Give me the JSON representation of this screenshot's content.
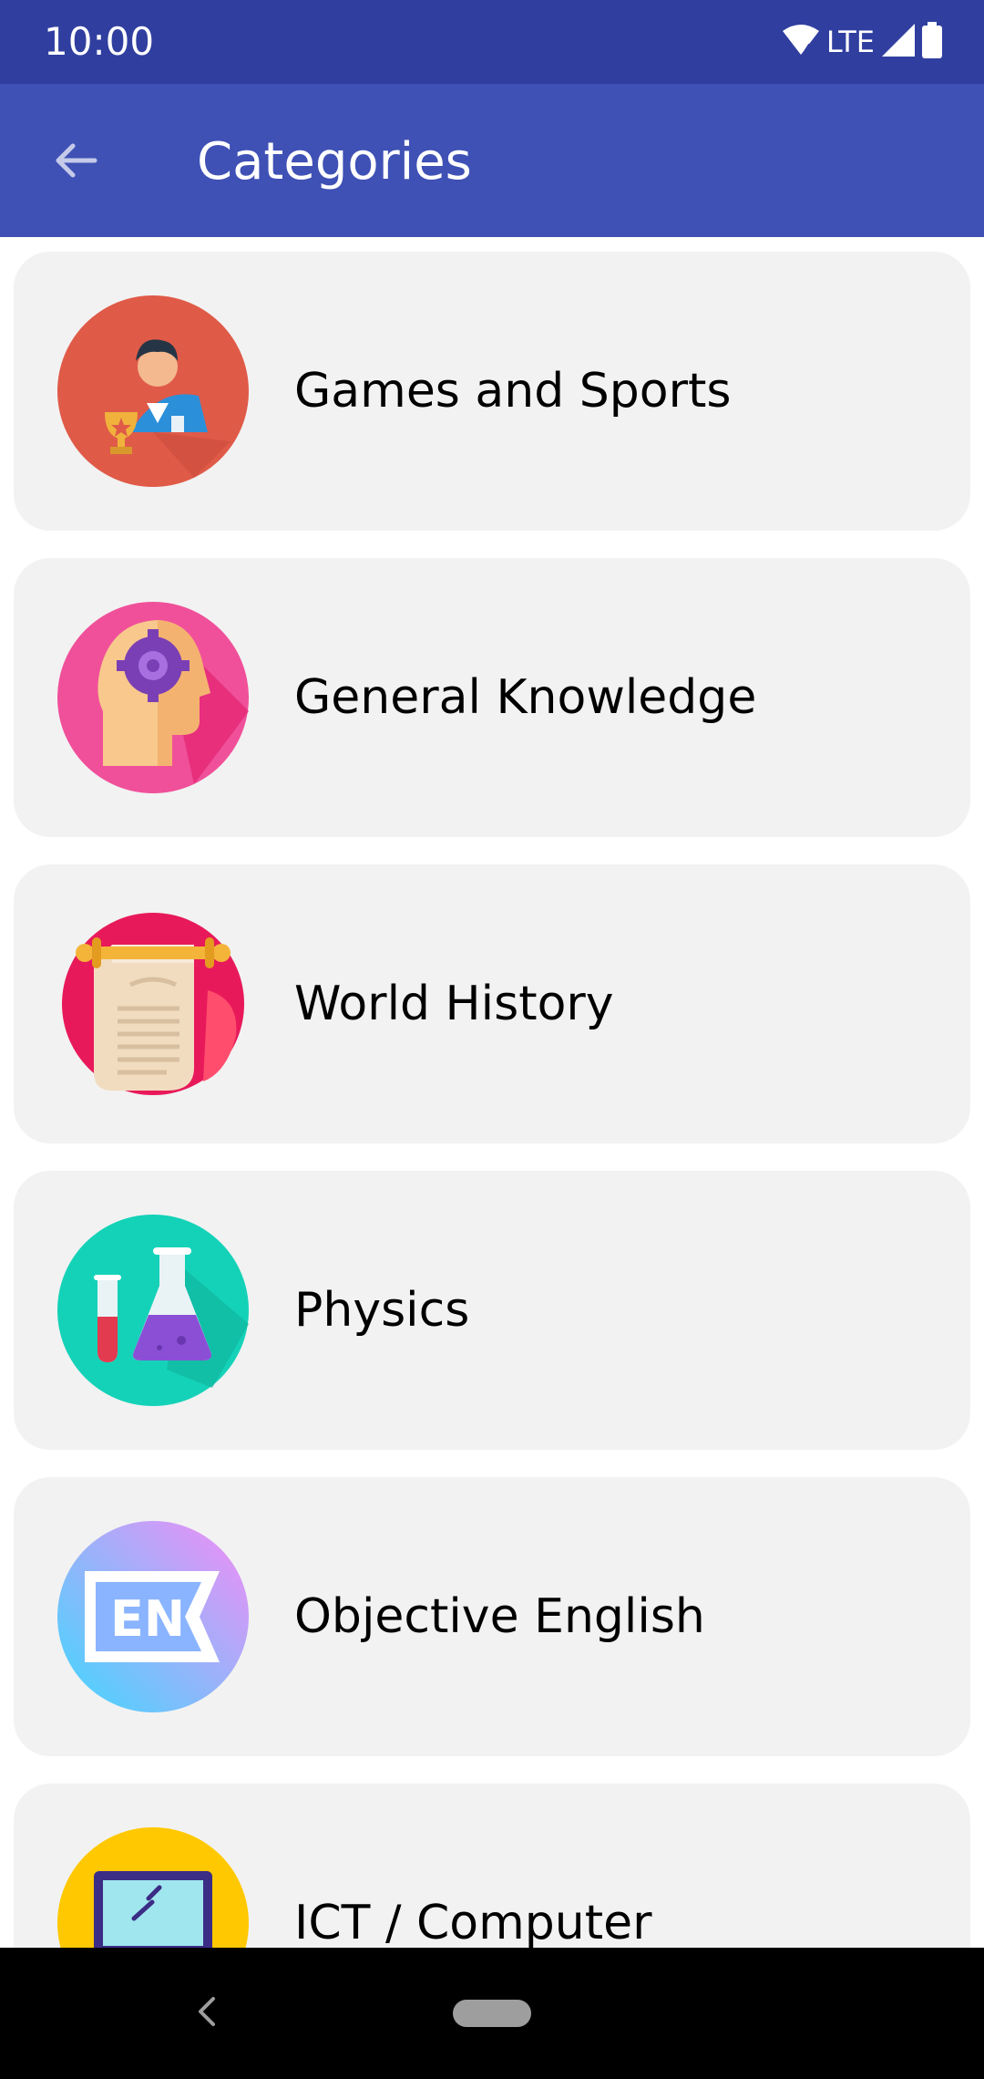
{
  "status_bar": {
    "time": "10:00",
    "network": "LTE",
    "icons": [
      "wifi-icon",
      "signal-icon",
      "battery-icon"
    ]
  },
  "app_bar": {
    "title": "Categories",
    "back_icon": "arrow-back-icon"
  },
  "categories": [
    {
      "label": "Games and Sports",
      "icon": "games-sports-icon",
      "color": "#e05a48"
    },
    {
      "label": "General Knowledge",
      "icon": "general-knowledge-icon",
      "color": "#f0509a"
    },
    {
      "label": "World History",
      "icon": "world-history-icon",
      "color": "#e8195a"
    },
    {
      "label": "Physics",
      "icon": "physics-icon",
      "color": "#14d2b8"
    },
    {
      "label": "Objective English",
      "icon": "objective-english-icon",
      "color": "#9aa6ff"
    },
    {
      "label": "ICT / Computer",
      "icon": "ict-computer-icon",
      "color": "#ffc800"
    }
  ],
  "colors": {
    "status_bar": "#303f9f",
    "app_bar": "#3f51b5",
    "card_background": "#f2f2f2"
  },
  "nav_bar": {
    "back_icon": "nav-back-icon",
    "home_icon": "nav-home-pill"
  }
}
